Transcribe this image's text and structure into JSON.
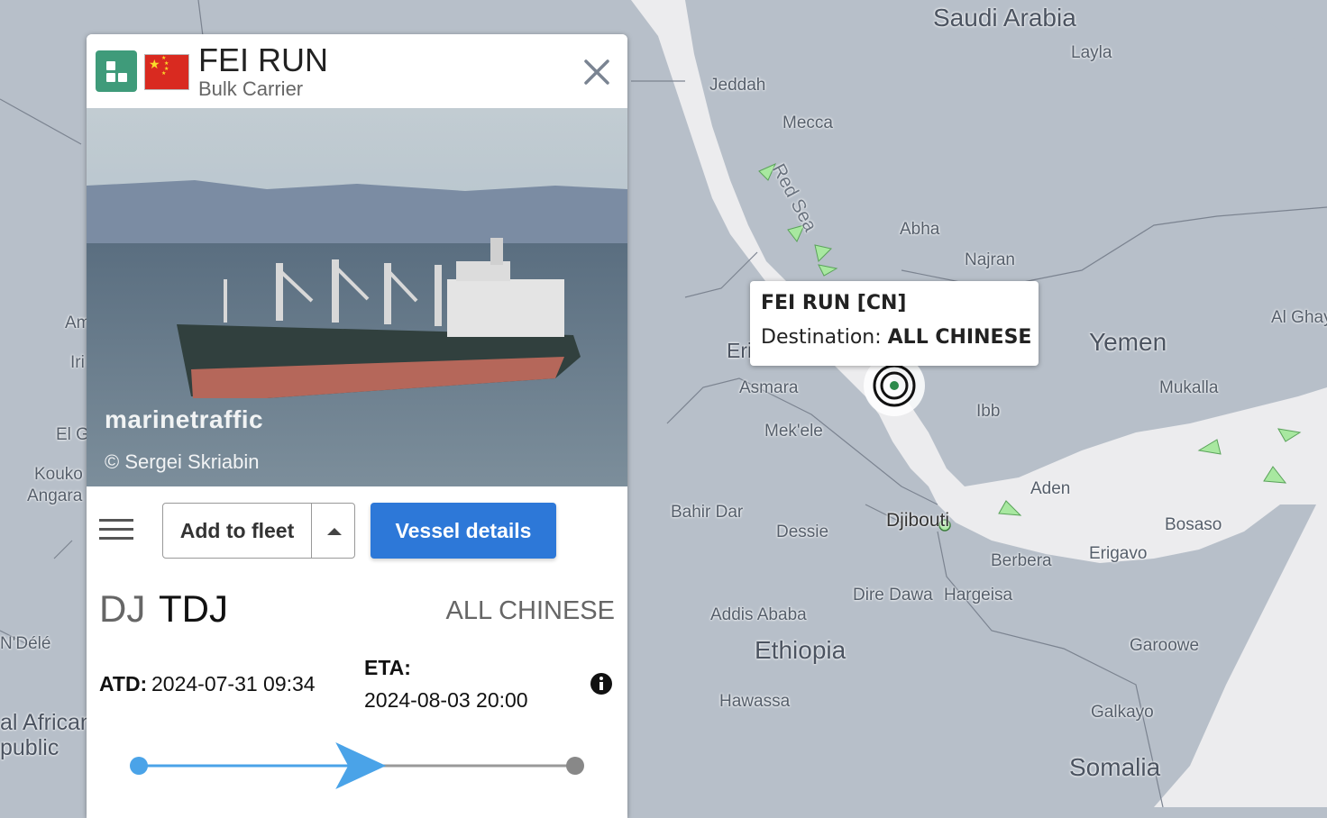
{
  "map": {
    "countries": [
      "Saudi Arabia",
      "Yemen",
      "Eritrea",
      "Ethiopia",
      "Somalia",
      "Djibouti"
    ],
    "cities": [
      "Jeddah",
      "Mecca",
      "Layla",
      "Abha",
      "Najran",
      "Asmara",
      "Mek'ele",
      "Ibb",
      "Aden",
      "Mukalla",
      "Al Ghay",
      "Bosaso",
      "Berbera",
      "Erigavo",
      "Bahir Dar",
      "Dessie",
      "Dire Dawa",
      "Hargeisa",
      "Addis Ababa",
      "Garoowe",
      "Hawassa",
      "Galkayo",
      "Am",
      "Iri",
      "El G",
      "Kouko",
      "Angara",
      "N'Délé",
      "al African",
      "public"
    ],
    "sea_label": "Red Sea",
    "colors": {
      "land": "#b7bfc9",
      "water": "#ececee",
      "vessel_arrow": "#a8e8a0"
    }
  },
  "tooltip": {
    "title": "FEI RUN [CN]",
    "destination_label": "Destination:",
    "destination_value": "ALL CHINESE"
  },
  "vessel": {
    "name": "FEI RUN",
    "type": "Bulk Carrier",
    "flag_icon": "china-flag-icon",
    "type_icon": "bulk-carrier-icon"
  },
  "photo": {
    "watermark": "marinetraffic",
    "credit": "© Sergei Skriabin"
  },
  "actions": {
    "add_to_fleet": "Add to fleet",
    "vessel_details": "Vessel details"
  },
  "route": {
    "departure_country": "DJ",
    "departure_port": "TDJ",
    "destination": "ALL CHINESE"
  },
  "times": {
    "atd_label": "ATD:",
    "atd_value": "2024-07-31 09:34",
    "eta_label": "ETA:",
    "eta_value": "2024-08-03 20:00"
  },
  "progress": {
    "fraction": 0.55,
    "color": "#4aa3e8"
  }
}
